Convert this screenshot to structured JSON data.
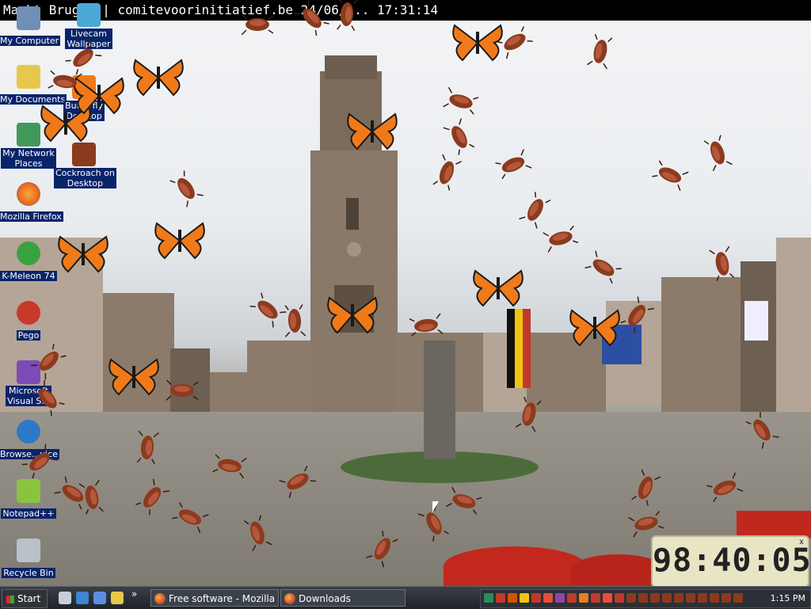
{
  "window": {
    "title": "Markt Brugge | comitevoorinitiatief.be 24/06/... 17:31:14"
  },
  "desktop": {
    "icons": [
      {
        "label": "My Computer",
        "icon": "computer-icon",
        "color": "#6f8fb6"
      },
      {
        "label": "Livecam\nWallpaper",
        "icon": "livecam-icon",
        "color": "#4aa9d6"
      },
      {
        "label": "My Documents",
        "icon": "folder-icon",
        "color": "#e8c84a"
      },
      {
        "label": "Butterfly\nDesktop",
        "icon": "butterfly-shortcut-icon",
        "color": "#f07a1a"
      },
      {
        "label": "My Network\nPlaces",
        "icon": "network-icon",
        "color": "#3f9a5a"
      },
      {
        "label": "Cockroach on\nDesktop",
        "icon": "cockroach-shortcut-icon",
        "color": "#8b3a1e"
      },
      {
        "label": "Mozilla Firefox",
        "icon": "firefox-icon",
        "color": "#e66a1f"
      },
      {
        "label": "K-Meleon 74",
        "icon": "kmeleon-icon",
        "color": "#3aa140"
      },
      {
        "label": "Pego",
        "icon": "pego-icon",
        "color": "#c9392b"
      },
      {
        "label": "Microsoft\nVisual S...",
        "icon": "visual-studio-icon",
        "color": "#7d4bb5"
      },
      {
        "label": "Browse...vice",
        "icon": "browser-service-icon",
        "color": "#2d79c7"
      },
      {
        "label": "Notepad++",
        "icon": "notepadpp-icon",
        "color": "#8ac43f"
      },
      {
        "label": "Recycle Bin",
        "icon": "recycle-bin-icon",
        "color": "#b9c1c9"
      }
    ]
  },
  "clock_widget": {
    "time": "98:40:05",
    "close": "x"
  },
  "taskbar": {
    "start_label": "Start",
    "tasks": [
      {
        "label": "Free software - Mozilla Fir..."
      },
      {
        "label": "Downloads"
      }
    ],
    "tray_time": "1:15 PM",
    "quick_launch": [
      {
        "icon": "show-desktop-icon",
        "color": "#c9cfd6"
      },
      {
        "icon": "ie-icon",
        "color": "#3d86d6"
      },
      {
        "icon": "outlook-icon",
        "color": "#5c8ee0"
      },
      {
        "icon": "explorer-icon",
        "color": "#e8c84a"
      }
    ]
  },
  "colors": {
    "taskbar": "#20242a",
    "label_bg": "#0a246a",
    "butterfly": "#f07a1a",
    "cockroach": "#8b3a1e"
  }
}
